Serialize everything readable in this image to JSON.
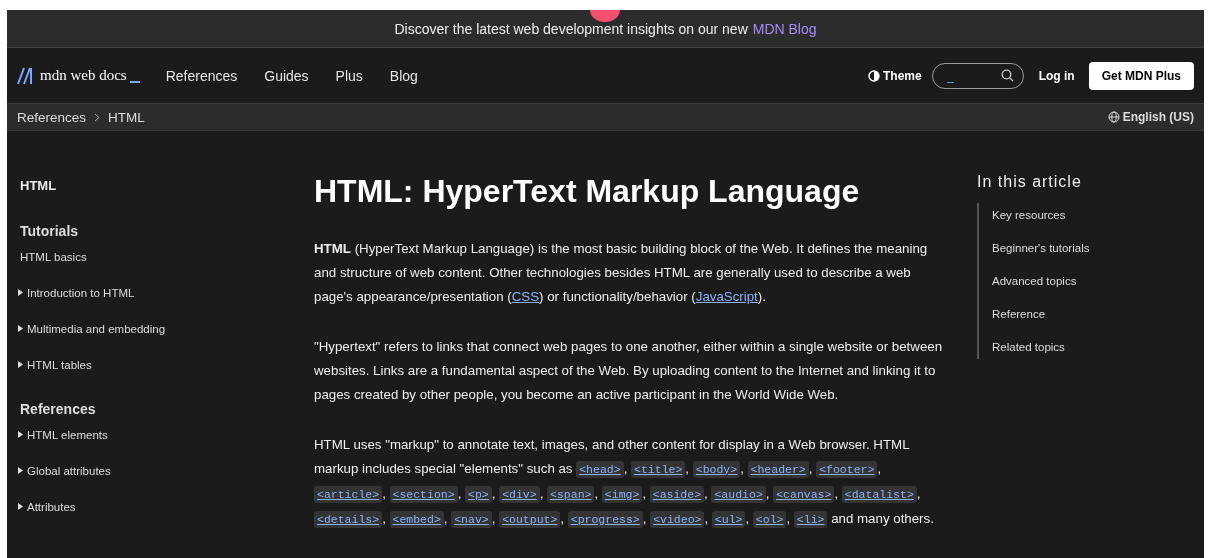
{
  "banner": {
    "text": "Discover the latest web development insights on our new",
    "link": "MDN Blog"
  },
  "header": {
    "logo": "mdn web docs",
    "nav": [
      "References",
      "Guides",
      "Plus",
      "Blog"
    ],
    "theme": "Theme",
    "search": {
      "placeholder": "_"
    },
    "login": "Log in",
    "cta": "Get MDN Plus"
  },
  "breadcrumbs": [
    "References",
    "HTML"
  ],
  "language": "English (US)",
  "sidebar": {
    "title": "HTML",
    "items": [
      {
        "kind": "heading",
        "label": "Tutorials"
      },
      {
        "kind": "link",
        "label": "HTML basics"
      },
      {
        "kind": "group",
        "label": "Introduction to HTML",
        "expanded": false
      },
      {
        "kind": "group",
        "label": "Multimedia and embedding",
        "expanded": false
      },
      {
        "kind": "group",
        "label": "HTML tables",
        "expanded": false
      },
      {
        "kind": "heading",
        "label": "References"
      },
      {
        "kind": "group",
        "label": "HTML elements",
        "expanded": false
      },
      {
        "kind": "group",
        "label": "Global attributes",
        "expanded": false
      },
      {
        "kind": "group",
        "label": "Attributes",
        "expanded": false
      }
    ]
  },
  "article": {
    "title": "HTML: HyperText Markup Language",
    "paragraphs": [
      [
        {
          "kind": "text",
          "text": "**HTML** (HyperText Markup Language) is the most basic building block of the Web. It defines the meaning and structure of web content. Other technologies besides HTML are generally used to describe a web page's appearance/presentation ("
        },
        {
          "kind": "link",
          "text": "CSS"
        },
        {
          "kind": "text",
          "text": ") or functionality/behavior ("
        },
        {
          "kind": "link",
          "text": "JavaScript"
        },
        {
          "kind": "text",
          "text": ")."
        }
      ],
      [
        {
          "kind": "text",
          "text": "\"Hypertext\" refers to links that connect web pages to one another, either within a single website or between websites. Links are a fundamental aspect of the Web. By uploading content to the Internet and linking it to pages created by other people, you become an active participant in the World Wide Web."
        }
      ],
      [
        {
          "kind": "text",
          "text": "HTML uses \"markup\" to annotate text, images, and other content for display in a Web browser. HTML markup includes special \"elements\" such as "
        },
        {
          "kind": "code",
          "text": "<head>"
        },
        {
          "kind": "text",
          "text": ", "
        },
        {
          "kind": "code",
          "text": "<title>"
        },
        {
          "kind": "text",
          "text": ", "
        },
        {
          "kind": "code",
          "text": "<body>"
        },
        {
          "kind": "text",
          "text": ", "
        },
        {
          "kind": "code",
          "text": "<header>"
        },
        {
          "kind": "text",
          "text": ", "
        },
        {
          "kind": "code",
          "text": "<footer>"
        },
        {
          "kind": "text",
          "text": ", "
        },
        {
          "kind": "code",
          "text": "<article>"
        },
        {
          "kind": "text",
          "text": ", "
        },
        {
          "kind": "code",
          "text": "<section>"
        },
        {
          "kind": "text",
          "text": ", "
        },
        {
          "kind": "code",
          "text": "<p>"
        },
        {
          "kind": "text",
          "text": ", "
        },
        {
          "kind": "code",
          "text": "<div>"
        },
        {
          "kind": "text",
          "text": ", "
        },
        {
          "kind": "code",
          "text": "<span>"
        },
        {
          "kind": "text",
          "text": ", "
        },
        {
          "kind": "code",
          "text": "<img>"
        },
        {
          "kind": "text",
          "text": ", "
        },
        {
          "kind": "code",
          "text": "<aside>"
        },
        {
          "kind": "text",
          "text": ", "
        },
        {
          "kind": "code",
          "text": "<audio>"
        },
        {
          "kind": "text",
          "text": ", "
        },
        {
          "kind": "code",
          "text": "<canvas>"
        },
        {
          "kind": "text",
          "text": ", "
        },
        {
          "kind": "code",
          "text": "<datalist>"
        },
        {
          "kind": "text",
          "text": ", "
        },
        {
          "kind": "code",
          "text": "<details>"
        },
        {
          "kind": "text",
          "text": ", "
        },
        {
          "kind": "code",
          "text": "<embed>"
        },
        {
          "kind": "text",
          "text": ", "
        },
        {
          "kind": "code",
          "text": "<nav>"
        },
        {
          "kind": "text",
          "text": ", "
        },
        {
          "kind": "code",
          "text": "<output>"
        },
        {
          "kind": "text",
          "text": ", "
        },
        {
          "kind": "code",
          "text": "<progress>"
        },
        {
          "kind": "text",
          "text": ", "
        },
        {
          "kind": "code",
          "text": "<video>"
        },
        {
          "kind": "text",
          "text": ", "
        },
        {
          "kind": "code",
          "text": "<ul>"
        },
        {
          "kind": "text",
          "text": ", "
        },
        {
          "kind": "code",
          "text": "<ol>"
        },
        {
          "kind": "text",
          "text": ", "
        },
        {
          "kind": "code",
          "text": "<li>"
        },
        {
          "kind": "text",
          "text": " and many others."
        }
      ]
    ]
  },
  "toc": {
    "title": "In this article",
    "items": [
      "Key resources",
      "Beginner's tutorials",
      "Advanced topics",
      "Reference",
      "Related topics"
    ]
  }
}
